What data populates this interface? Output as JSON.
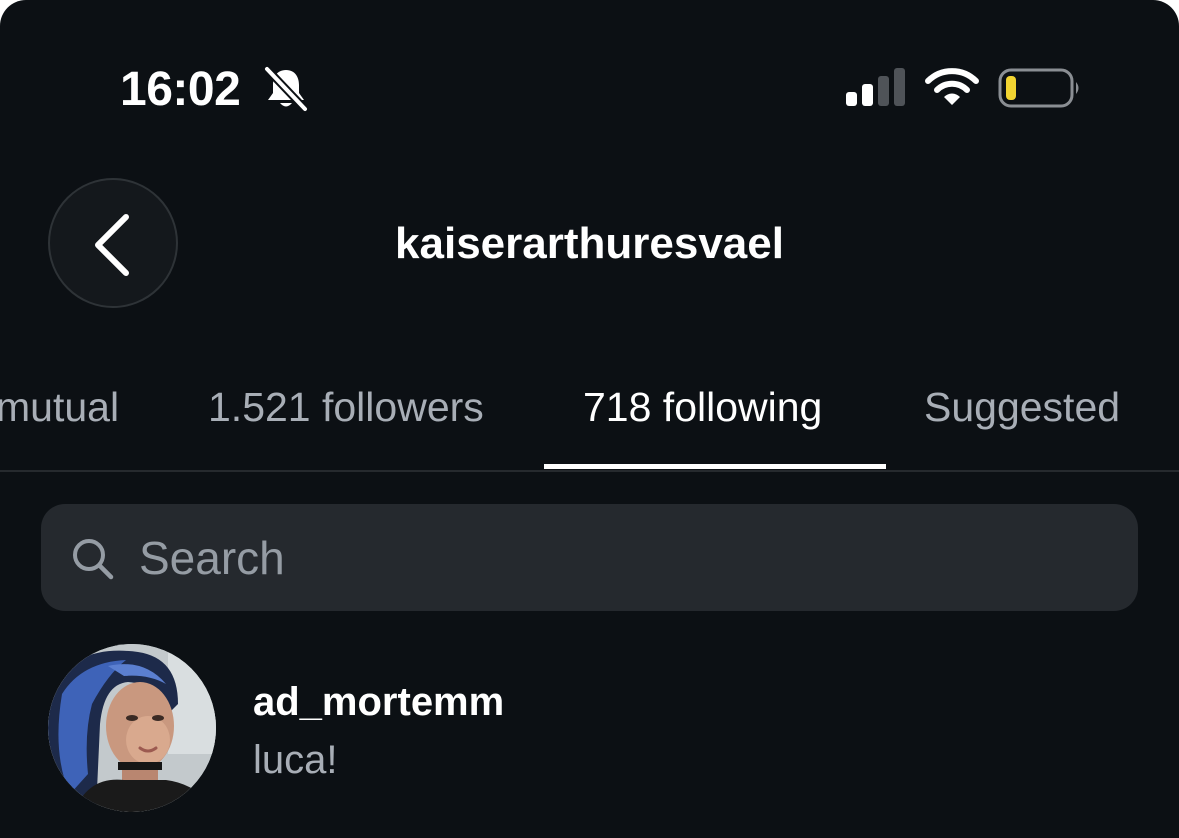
{
  "status_bar": {
    "time": "16:02",
    "icons": [
      "bell-slash-icon",
      "cellular-signal-icon",
      "wifi-icon",
      "battery-low-icon"
    ]
  },
  "header": {
    "title": "kaiserarthuresvael",
    "back_icon": "chevron-left-icon"
  },
  "tabs": [
    {
      "label": "mutual",
      "active": false
    },
    {
      "label": "1.521 followers",
      "active": false
    },
    {
      "label": "718 following",
      "active": true
    },
    {
      "label": "Suggested",
      "active": false
    }
  ],
  "search": {
    "placeholder": "Search",
    "icon": "search-icon"
  },
  "list": [
    {
      "username": "ad_mortemm",
      "subtitle": "luca!"
    }
  ],
  "colors": {
    "background": "#0c1014",
    "search_background": "#25292e",
    "muted_text": "#a8aeb6",
    "battery_fill": "#f2d431"
  }
}
